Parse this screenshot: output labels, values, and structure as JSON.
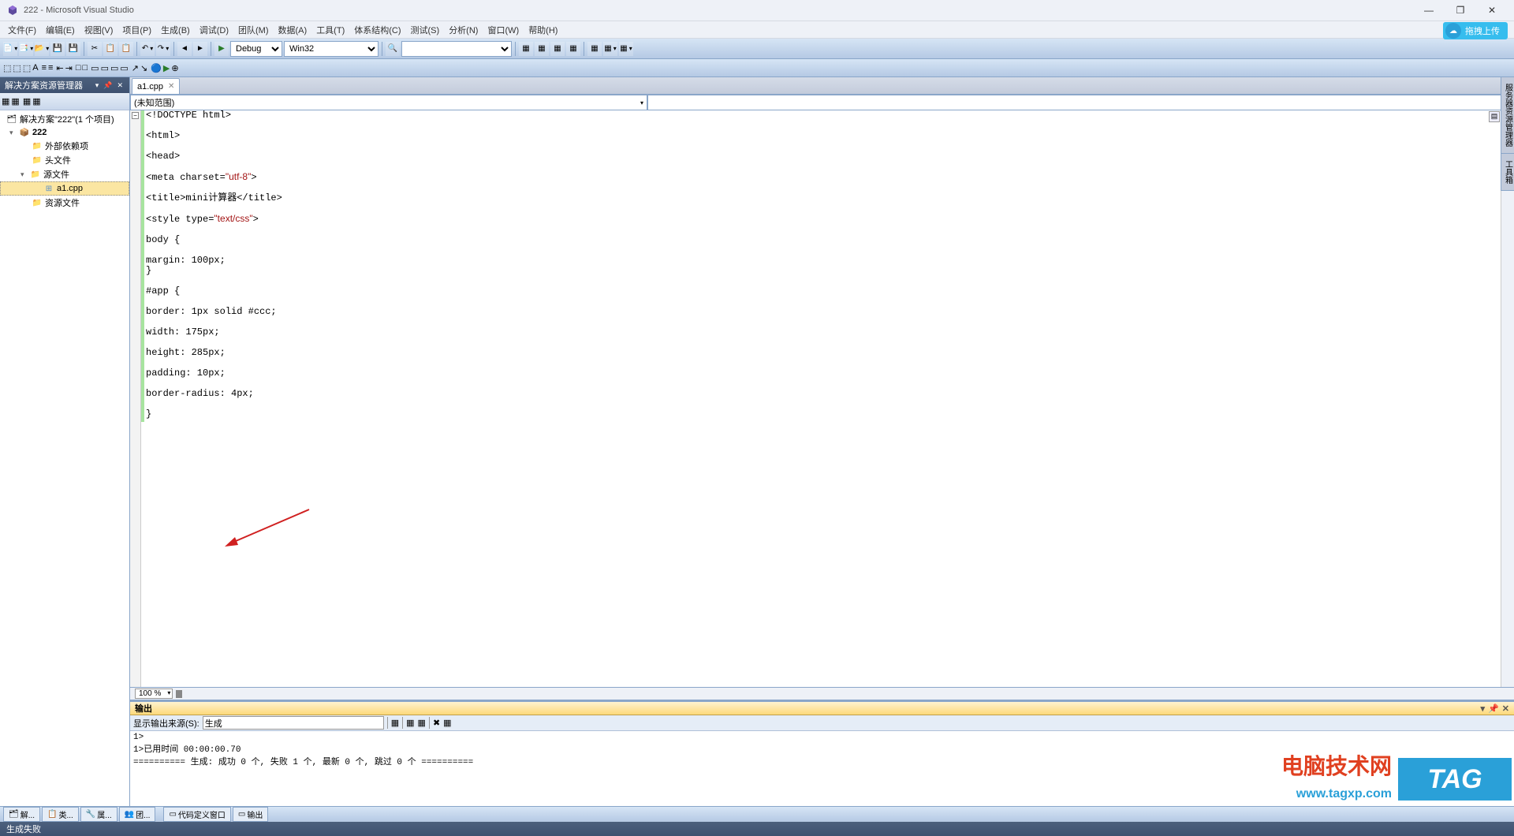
{
  "window": {
    "title": "222 - Microsoft Visual Studio"
  },
  "menu": [
    "文件(F)",
    "编辑(E)",
    "视图(V)",
    "项目(P)",
    "生成(B)",
    "调试(D)",
    "团队(M)",
    "数据(A)",
    "工具(T)",
    "体系结构(C)",
    "测试(S)",
    "分析(N)",
    "窗口(W)",
    "帮助(H)"
  ],
  "cloud_button": "拖拽上传",
  "toolbar": {
    "config": "Debug",
    "platform": "Win32"
  },
  "solution_explorer": {
    "title": "解决方案资源管理器",
    "root": "解决方案\"222\"(1 个项目)",
    "project": "222",
    "folders": {
      "external": "外部依赖项",
      "header": "头文件",
      "source": "源文件",
      "resource": "资源文件"
    },
    "file": "a1.cpp"
  },
  "tabs": {
    "active": "a1.cpp"
  },
  "nav_combo": "(未知范围)",
  "code_lines": [
    "<!DOCTYPE html>",
    "",
    "<html>",
    "",
    "<head>",
    "",
    "<meta charset=\"utf-8\">",
    "",
    "<title>mini计算器</title>",
    "",
    "<style type=\"text/css\">",
    "",
    "body {",
    "",
    "margin: 100px;",
    "}",
    "",
    "#app {",
    "",
    "border: 1px solid #ccc;",
    "",
    "width: 175px;",
    "",
    "height: 285px;",
    "",
    "padding: 10px;",
    "",
    "border-radius: 4px;",
    "",
    "}",
    ""
  ],
  "zoom": "100 %",
  "output": {
    "title": "输出",
    "source_label": "显示输出来源(S):",
    "source_value": "生成",
    "lines": [
      "1>",
      "1>已用时间 00:00:00.70",
      "========== 生成: 成功 0 个, 失败 1 个, 最新 0 个, 跳过 0 个 =========="
    ]
  },
  "bottom_tabs": [
    "解...",
    "类...",
    "属...",
    "团..."
  ],
  "bottom_tabs2": [
    "代码定义窗口",
    "输出"
  ],
  "statusbar": "生成失败",
  "side_tabs": [
    "服务器资源管理器",
    "工具箱"
  ],
  "watermark": {
    "text1": "电脑技术网",
    "text2": "www.tagxp.com",
    "tag": "TAG"
  }
}
